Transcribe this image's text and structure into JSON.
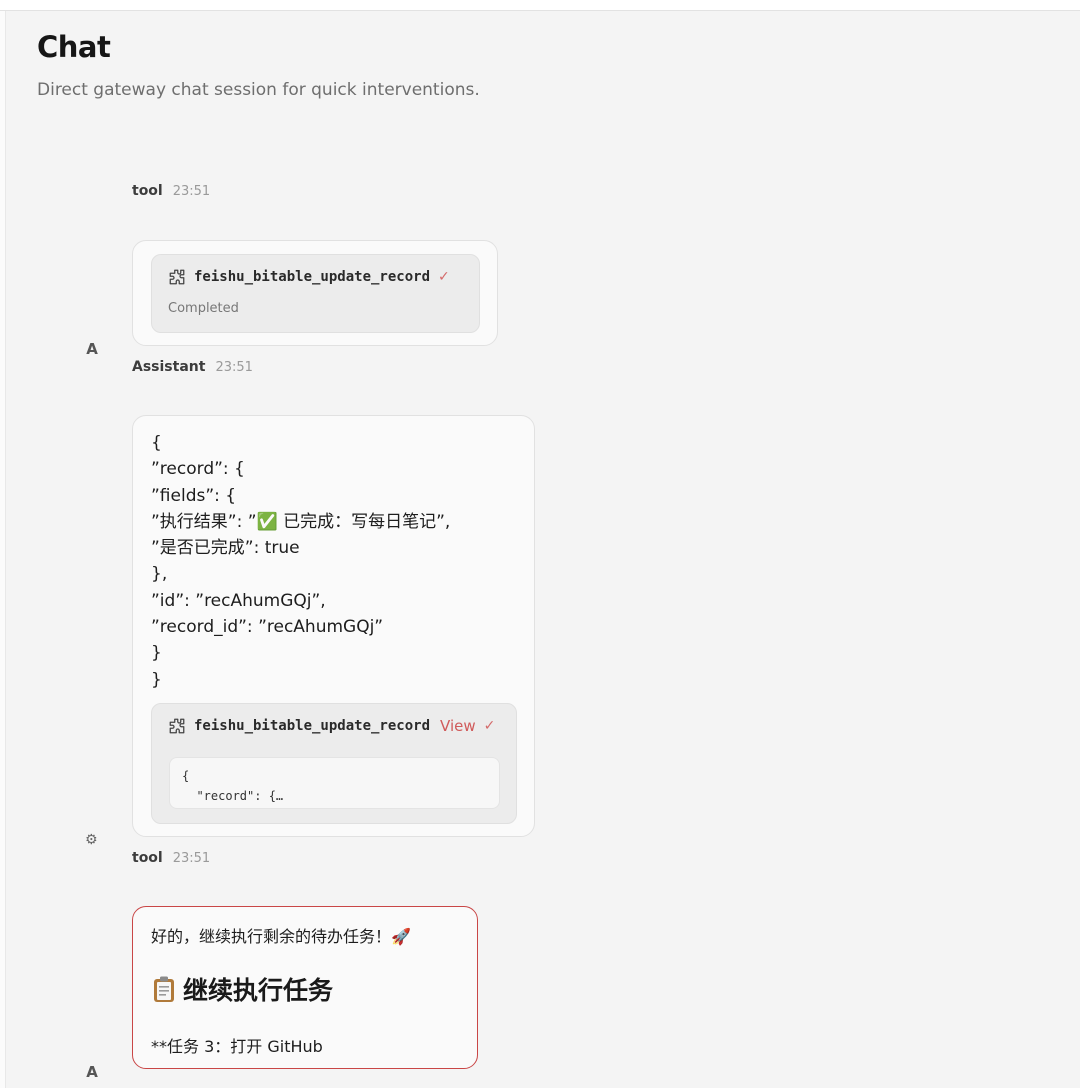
{
  "page": {
    "title": "Chat",
    "subtitle": "Direct gateway chat session for quick interventions."
  },
  "messages": [
    {
      "role": "tool",
      "time": "23:51",
      "tool": {
        "name": "feishu_bitable_update_record",
        "check": "✓",
        "status": "Completed"
      }
    },
    {
      "avatar": "A",
      "role": "Assistant",
      "time": "23:51",
      "body_lines": [
        "{",
        "”record”: {",
        "”fields”: {",
        "”执行结果”: ”✅ 已完成：写每日笔记”,",
        "”是否已完成”: true",
        "},",
        "”id”: ”recAhumGQj”,",
        "”record_id”: ”recAhumGQj”",
        "}",
        "}"
      ],
      "tool": {
        "name": "feishu_bitable_update_record",
        "view_label": "View",
        "check": "✓",
        "preview": "{\n  \"record\": {…"
      }
    },
    {
      "avatar_icon": "gear-icon",
      "avatar_glyph": "⚙",
      "role": "tool",
      "time": "23:51"
    },
    {
      "avatar": "A",
      "line1": "好的，继续执行剩余的待办任务！🚀",
      "heading_icon": "clipboard-icon",
      "heading": "继续执行任务",
      "line3": "**任务 3：打开 GitHub"
    }
  ],
  "colors": {
    "accent": "#c94646",
    "background": "#f4f4f4",
    "card": "#fafafa"
  }
}
